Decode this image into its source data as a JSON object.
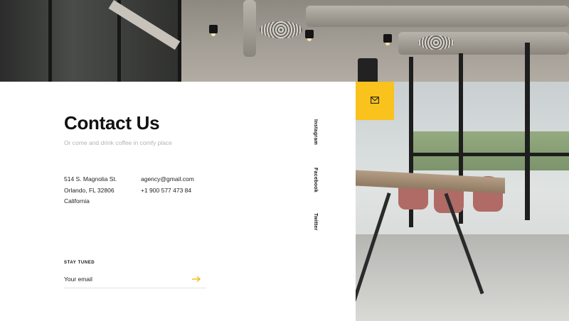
{
  "contact": {
    "title": "Contact Us",
    "subtitle": "Or come and drink coffee in comfy place",
    "address": [
      "514 S. Magnolia St.",
      "Orlando, FL 32806",
      "California"
    ],
    "email": "agency@gmail.com",
    "phone": "+1 900 577 473 84"
  },
  "newsletter": {
    "label": "STAY TUNED",
    "placeholder": "Your email",
    "submit_icon": "arrow-right-icon"
  },
  "social": [
    "Instagram",
    "Facebook",
    "Twitter"
  ],
  "mail_button": {
    "icon": "mail-icon"
  },
  "colors": {
    "accent": "#f9c21d",
    "panel": "#ffffff",
    "text": "#111111",
    "muted": "#b3b3b3"
  }
}
